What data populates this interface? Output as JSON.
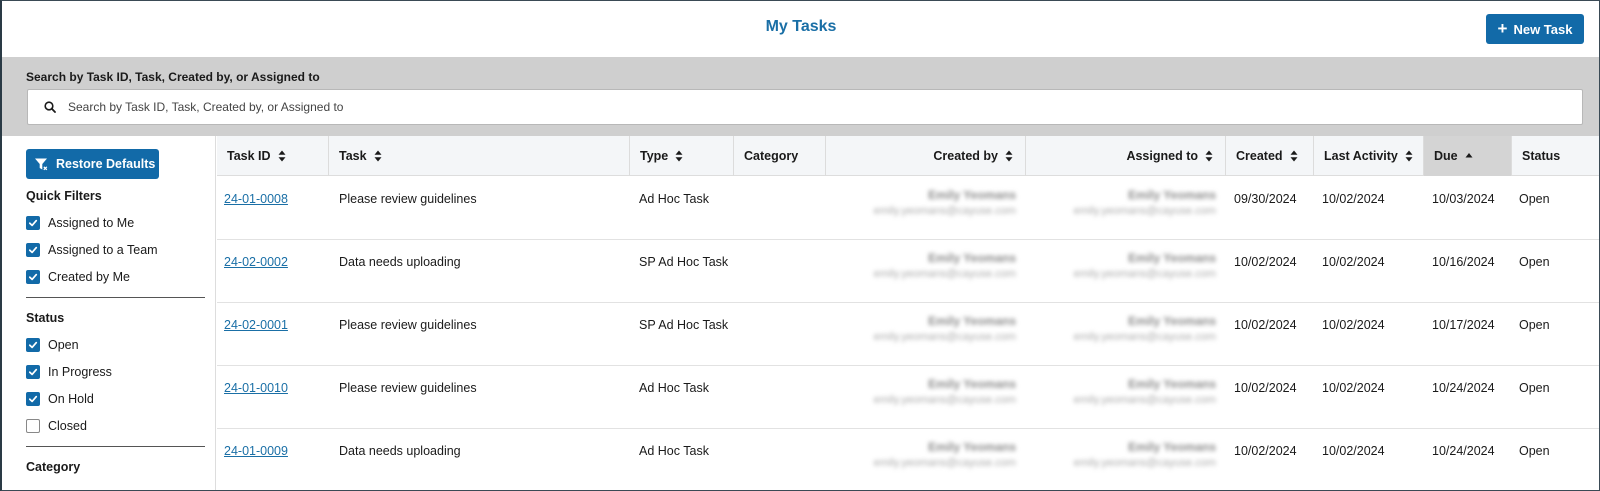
{
  "header": {
    "title": "My Tasks",
    "new_task_label": "New Task"
  },
  "search": {
    "label": "Search by Task ID, Task, Created by, or Assigned to",
    "placeholder": "Search by Task ID, Task, Created by, or Assigned to",
    "value": ""
  },
  "sidebar": {
    "restore_label": "Restore Defaults",
    "quick_filters_heading": "Quick Filters",
    "quick_filters": [
      {
        "label": "Assigned to Me",
        "checked": true
      },
      {
        "label": "Assigned to a Team",
        "checked": true
      },
      {
        "label": "Created by Me",
        "checked": true
      }
    ],
    "status_heading": "Status",
    "status": [
      {
        "label": "Open",
        "checked": true
      },
      {
        "label": "In Progress",
        "checked": true
      },
      {
        "label": "On Hold",
        "checked": true
      },
      {
        "label": "Closed",
        "checked": false
      }
    ],
    "category_heading": "Category"
  },
  "table": {
    "columns": [
      {
        "label": "Task ID",
        "sort": "none"
      },
      {
        "label": "Task",
        "sort": "none"
      },
      {
        "label": "Type",
        "sort": "none"
      },
      {
        "label": "Category",
        "sort": "none"
      },
      {
        "label": "Created by",
        "sort": "none"
      },
      {
        "label": "Assigned to",
        "sort": "none"
      },
      {
        "label": "Created",
        "sort": "none"
      },
      {
        "label": "Last Activity",
        "sort": "none"
      },
      {
        "label": "Due",
        "sort": "ascending"
      },
      {
        "label": "Status",
        "sort": "none"
      }
    ],
    "rows": [
      {
        "task_id": "24-01-0008",
        "task": "Please review guidelines",
        "type": "Ad Hoc Task",
        "category": "",
        "created_by_name": "Emily Yeomans",
        "created_by_email": "emily.yeomans@cayuse.com",
        "assigned_to_name": "Emily Yeomans",
        "assigned_to_email": "emily.yeomans@cayuse.com",
        "created": "09/30/2024",
        "last_activity": "10/02/2024",
        "due": "10/03/2024",
        "status": "Open"
      },
      {
        "task_id": "24-02-0002",
        "task": "Data needs uploading",
        "type": "SP Ad Hoc Task",
        "category": "",
        "created_by_name": "Emily Yeomans",
        "created_by_email": "emily.yeomans@cayuse.com",
        "assigned_to_name": "Emily Yeomans",
        "assigned_to_email": "emily.yeomans@cayuse.com",
        "created": "10/02/2024",
        "last_activity": "10/02/2024",
        "due": "10/16/2024",
        "status": "Open"
      },
      {
        "task_id": "24-02-0001",
        "task": "Please review guidelines",
        "type": "SP Ad Hoc Task",
        "category": "",
        "created_by_name": "Emily Yeomans",
        "created_by_email": "emily.yeomans@cayuse.com",
        "assigned_to_name": "Emily Yeomans",
        "assigned_to_email": "emily.yeomans@cayuse.com",
        "created": "10/02/2024",
        "last_activity": "10/02/2024",
        "due": "10/17/2024",
        "status": "Open"
      },
      {
        "task_id": "24-01-0010",
        "task": "Please review guidelines",
        "type": "Ad Hoc Task",
        "category": "",
        "created_by_name": "Emily Yeomans",
        "created_by_email": "emily.yeomans@cayuse.com",
        "assigned_to_name": "Emily Yeomans",
        "assigned_to_email": "emily.yeomans@cayuse.com",
        "created": "10/02/2024",
        "last_activity": "10/02/2024",
        "due": "10/24/2024",
        "status": "Open"
      },
      {
        "task_id": "24-01-0009",
        "task": "Data needs uploading",
        "type": "Ad Hoc Task",
        "category": "",
        "created_by_name": "Emily Yeomans",
        "created_by_email": "emily.yeomans@cayuse.com",
        "assigned_to_name": "Emily Yeomans",
        "assigned_to_email": "emily.yeomans@cayuse.com",
        "created": "10/02/2024",
        "last_activity": "10/02/2024",
        "due": "10/24/2024",
        "status": "Open"
      }
    ]
  },
  "colors": {
    "accent": "#126aa8",
    "title": "#1a6fa6",
    "search_band": "#cfcfcf",
    "sorted_header": "#d4d4d4"
  },
  "icons": {
    "new_task": "plus-icon",
    "search": "search-icon",
    "restore": "filter-reset-icon",
    "checkbox": "check-icon",
    "sort": "sort-arrows-icon",
    "sort_asc": "sort-ascending-icon"
  }
}
